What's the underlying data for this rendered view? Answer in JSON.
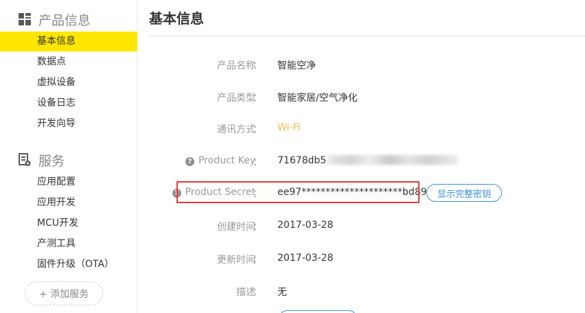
{
  "sidebar": {
    "product_section": {
      "label": "产品信息",
      "icon": "grid-icon",
      "items": [
        {
          "label": "基本信息",
          "active": true
        },
        {
          "label": "数据点",
          "active": false
        },
        {
          "label": "虚拟设备",
          "active": false
        },
        {
          "label": "设备日志",
          "active": false
        },
        {
          "label": "开发向导",
          "active": false
        }
      ]
    },
    "service_section": {
      "label": "服务",
      "icon": "document-gear-icon",
      "items": [
        {
          "label": "应用配置"
        },
        {
          "label": "应用开发"
        },
        {
          "label": "MCU开发"
        },
        {
          "label": "产测工具"
        },
        {
          "label": "固件升级（OTA）"
        }
      ]
    },
    "add_service_label": "+ 添加服务"
  },
  "main": {
    "title": "基本信息",
    "colon": "：",
    "fields": {
      "product_name": {
        "label": "产品名称",
        "value": "智能空净"
      },
      "product_type": {
        "label": "产品类型",
        "value": "智能家居/空气净化"
      },
      "comm_method": {
        "label": "通讯方式",
        "value": "Wi-Fi"
      },
      "product_key": {
        "label": "Product Key",
        "value": "71678db5"
      },
      "product_secret": {
        "label": "Product Secret",
        "value": "ee97*********************bd89"
      },
      "created_time": {
        "label": "创建时间",
        "value": "2017-03-28"
      },
      "updated_time": {
        "label": "更新时间",
        "value": "2017-03-28"
      },
      "description": {
        "label": "描述",
        "value": "无"
      }
    },
    "reveal_secret_label": "显示完整密钥",
    "help_glyph": "?"
  },
  "colors": {
    "active_nav": "#ffe600",
    "highlight_border": "#e53935",
    "link_blue": "#3d8fd9",
    "wifi_orange": "#f5b84c"
  }
}
